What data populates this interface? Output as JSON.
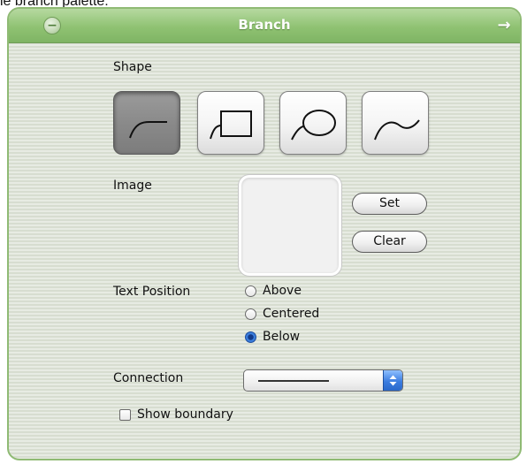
{
  "caption": "ie branch palette:",
  "window": {
    "title": "Branch"
  },
  "shape": {
    "label": "Shape",
    "options": [
      {
        "name": "curve-up",
        "selected": true
      },
      {
        "name": "rectangle",
        "selected": false
      },
      {
        "name": "ellipse",
        "selected": false
      },
      {
        "name": "wave",
        "selected": false
      }
    ]
  },
  "image": {
    "label": "Image",
    "set_label": "Set",
    "clear_label": "Clear"
  },
  "text_position": {
    "label": "Text Position",
    "options": [
      "Above",
      "Centered",
      "Below"
    ],
    "selected": "Below"
  },
  "connection": {
    "label": "Connection",
    "selected_style": "straight-line"
  },
  "show_boundary": {
    "label": "Show boundary",
    "checked": false
  },
  "colors": {
    "title_bar": "#8fc272",
    "border": "#8fba74",
    "selected_shape": "#8a8a8a",
    "radio_on": "#3f82e0"
  }
}
